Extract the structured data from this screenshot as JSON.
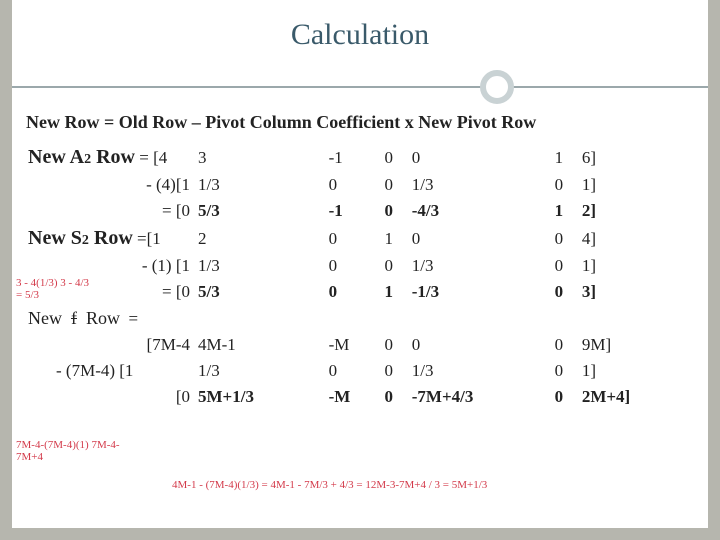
{
  "title": "Calculation",
  "formula": "New Row = Old Row – Pivot Column Coefficient x New Pivot Row",
  "sections": [
    {
      "head": "New A2 Row",
      "r1": {
        "lead": "= [4",
        "c": [
          "3",
          "-1",
          "0",
          "0",
          "1",
          "6]"
        ]
      },
      "r2": {
        "lead": "- (4)[1",
        "c": [
          "1/3",
          "0",
          "0",
          "1/3",
          "0",
          "1]"
        ]
      },
      "r3": {
        "lead": "=   [0",
        "c": [
          "5/3",
          "-1",
          "0",
          "-4/3",
          "1",
          "2]"
        ]
      }
    },
    {
      "head": "New S2 Row",
      "r1": {
        "lead": "=[1",
        "c": [
          "2",
          "0",
          "1",
          "0",
          "0",
          "4]"
        ]
      },
      "r2": {
        "lead": "- (1) [1",
        "c": [
          "1/3",
          "0",
          "0",
          "1/3",
          "0",
          "1]"
        ]
      },
      "r3": {
        "lead": "=   [0",
        "c": [
          "5/3",
          "0",
          "1",
          "-1/3",
          "0",
          "3]"
        ]
      }
    },
    {
      "head": "New  f  Row",
      "r0": {
        "lead": "=",
        "c": [
          "",
          "",
          "",
          "",
          "",
          ""
        ]
      },
      "r1": {
        "lead": "[7M-4",
        "c": [
          "4M-1",
          "-M",
          "0",
          "0",
          "0",
          "9M]"
        ]
      },
      "r2": {
        "lead": "- (7M-4) [1",
        "c": [
          "1/3",
          "0",
          "0",
          "1/3",
          "0",
          "1]"
        ]
      },
      "r3": {
        "lead": "[0",
        "c": [
          "5M+1/3",
          "-M",
          "0",
          "-7M+4/3",
          "0",
          "2M+4]"
        ]
      }
    }
  ],
  "annotations": {
    "a1": "3 - 4(1/3)\n3 - 4/3 = 5/3",
    "a2": "7M-4-(7M-4)(1)\n7M-4-7M+4",
    "a3": "4M-1 - (7M-4)(1/3) = 4M-1 - 7M/3 + 4/3 = 12M-3-7M+4 / 3\n= 5M+1/3"
  }
}
